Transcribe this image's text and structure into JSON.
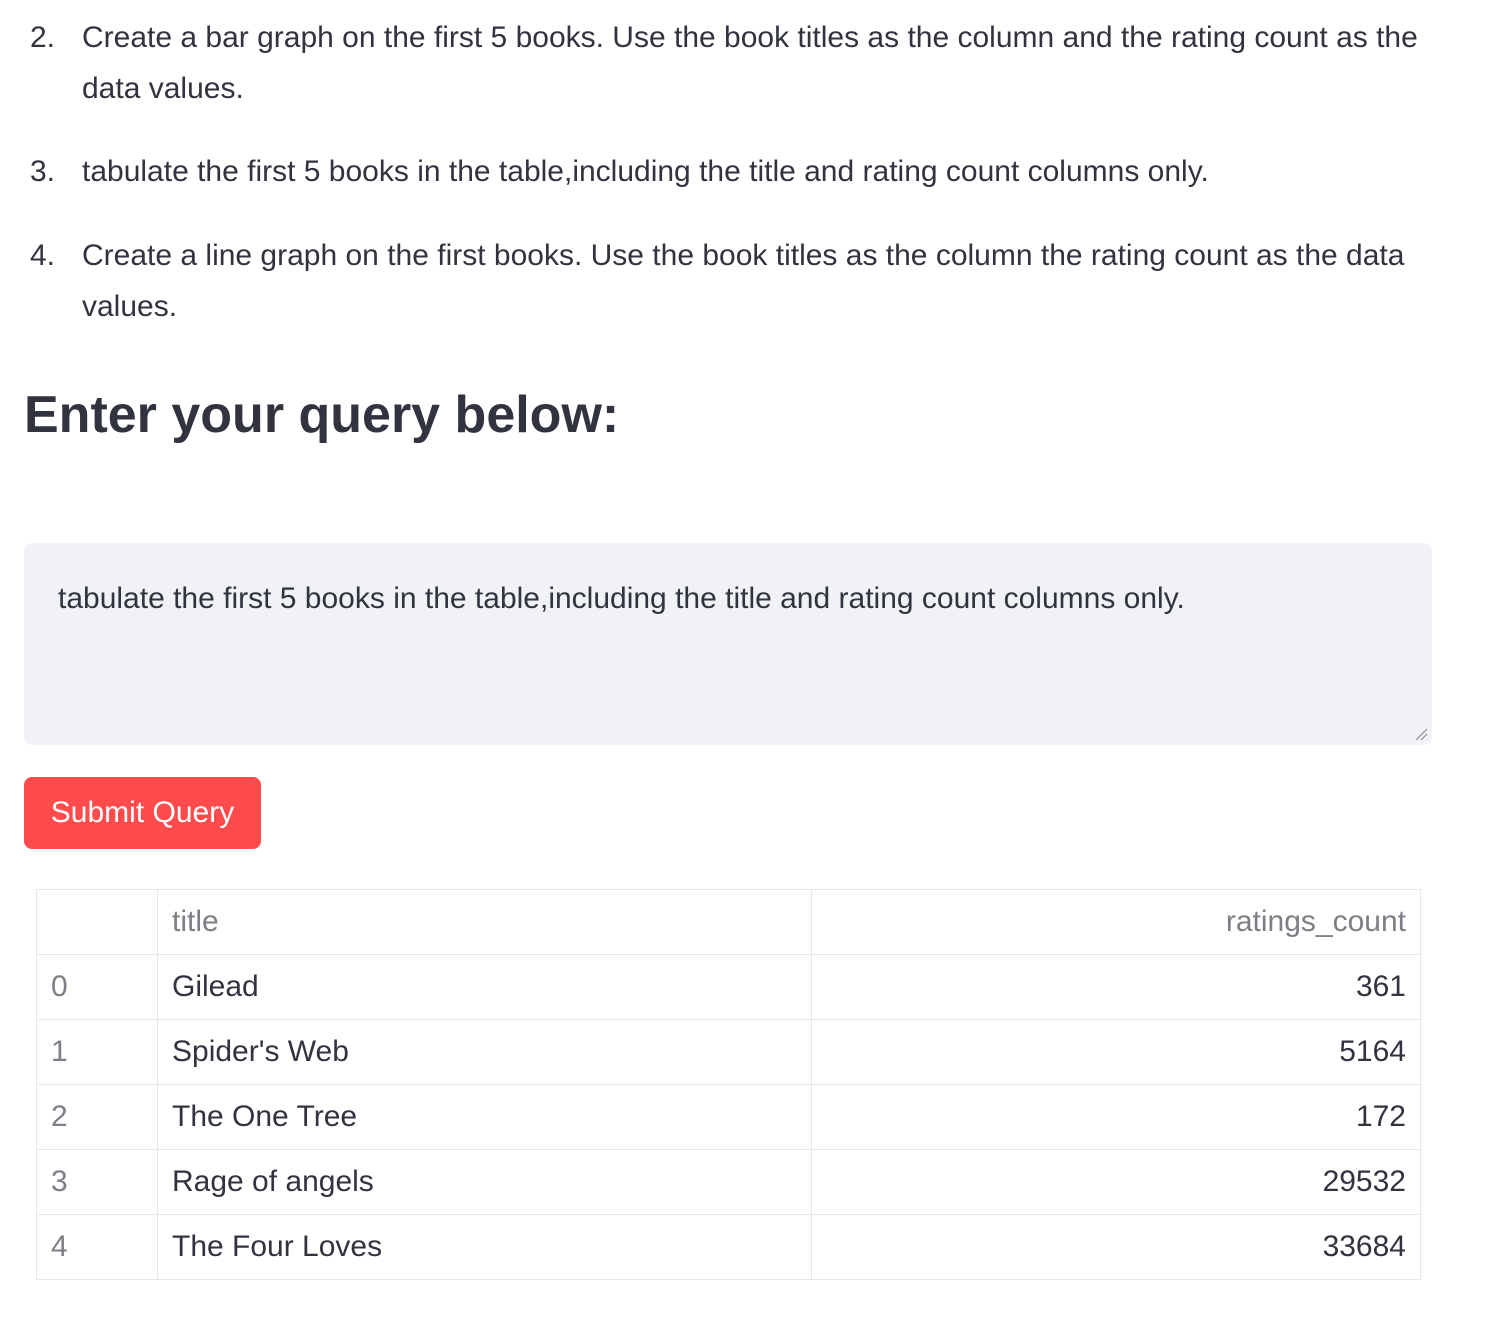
{
  "instructions": [
    {
      "number": "2.",
      "line1": "Create a bar graph on the first 5 books. Use the book titles as the column and the rating count as the",
      "line2": "data values."
    },
    {
      "number": "3.",
      "line1": "tabulate the first 5 books in the table,including the title and rating count columns only."
    },
    {
      "number": "4.",
      "line1": "Create a line graph on the first books. Use the book titles as the column the rating count as the data",
      "line2": "values."
    }
  ],
  "heading": "Enter your query below:",
  "query": {
    "value": "tabulate the first 5 books in the table,including the title and rating count columns only."
  },
  "submit_label": "Submit Query",
  "table": {
    "columns": [
      "",
      "title",
      "ratings_count"
    ],
    "rows": [
      {
        "index": "0",
        "title": "Gilead",
        "ratings_count": "361"
      },
      {
        "index": "1",
        "title": "Spider's Web",
        "ratings_count": "5164"
      },
      {
        "index": "2",
        "title": "The One Tree",
        "ratings_count": "172"
      },
      {
        "index": "3",
        "title": "Rage of angels",
        "ratings_count": "29532"
      },
      {
        "index": "4",
        "title": "The Four Loves",
        "ratings_count": "33684"
      }
    ]
  },
  "colors": {
    "text": "#31333f",
    "muted": "#7d7f86",
    "button": "#ff4b4b",
    "input_bg": "#f0f2f6",
    "border": "#e6e7eb"
  },
  "icons": {
    "resize": "resize-handle-icon"
  }
}
